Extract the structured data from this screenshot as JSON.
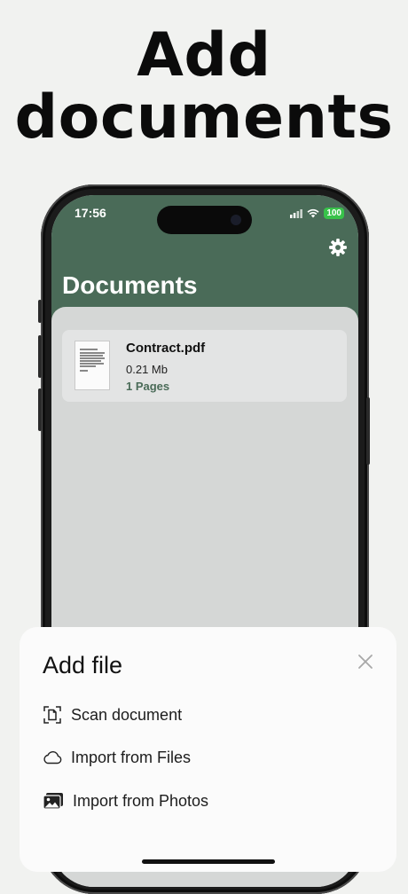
{
  "headline": {
    "line1": "Add",
    "line2": "documents"
  },
  "status_bar": {
    "time": "17:56",
    "battery": "100"
  },
  "app": {
    "title": "Documents",
    "documents": [
      {
        "name": "Contract.pdf",
        "size": "0.21 Mb",
        "pages": "1 Pages"
      }
    ]
  },
  "sheet": {
    "title": "Add file",
    "options": [
      {
        "label": "Scan document",
        "icon": "scan-icon"
      },
      {
        "label": "Import from Files",
        "icon": "cloud-icon"
      },
      {
        "label": "Import from Photos",
        "icon": "photos-icon"
      }
    ]
  },
  "colors": {
    "accent": "#4a6b58",
    "background": "#f1f2f0"
  }
}
